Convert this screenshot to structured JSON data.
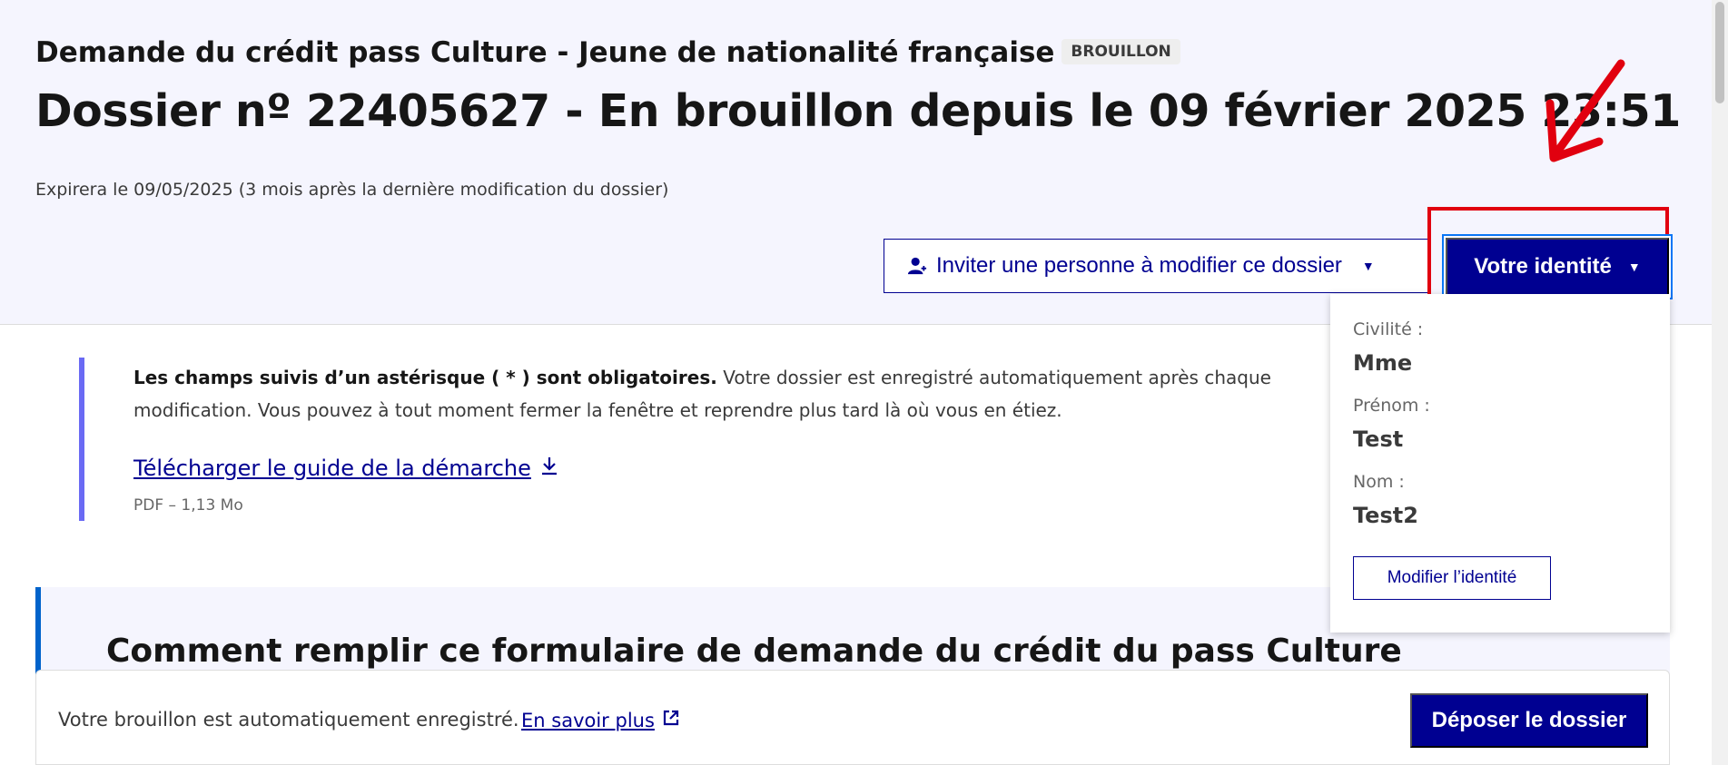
{
  "header": {
    "procedure_title": "Demande du crédit pass Culture - Jeune de nationalité française",
    "status_badge": "BROUILLON",
    "dossier_title": "Dossier nº 22405627 - En brouillon depuis le 09 février 2025 23:51",
    "expiry_text": "Expirera le 09/05/2025 (3 mois après la dernière modification du dossier)"
  },
  "actions": {
    "invite_label": "Inviter une personne à modifier ce dossier",
    "identity_label": "Votre identité",
    "caret_glyph": "▼"
  },
  "identity_dropdown": {
    "civility_label": "Civilité :",
    "civility_value": "Mme",
    "firstname_label": "Prénom :",
    "firstname_value": "Test",
    "lastname_label": "Nom :",
    "lastname_value": "Test2",
    "modify_label": "Modifier l’identité"
  },
  "notice": {
    "required_bold": "Les champs suivis d’un astérisque ( * ) sont obligatoires.",
    "autosave_text": " Votre dossier est enregistré automatiquement après chaque modification. Vous pouvez à tout moment fermer la fenêtre et reprendre plus tard là où vous en étiez.",
    "guide_link": "Télécharger le guide de la démarche",
    "guide_meta": "PDF – 1,13 Mo"
  },
  "howto": {
    "title": "Comment remplir ce formulaire de demande du crédit du pass Culture"
  },
  "save_bar": {
    "text": "Votre brouillon est automatiquement enregistré.",
    "learn_more": "En savoir plus",
    "submit_label": "Déposer le dossier"
  },
  "icons": {
    "invite": "person-add-icon",
    "caret": "caret-down-icon",
    "download": "download-icon",
    "external": "external-link-icon",
    "annotation": "red-arrow-annotation"
  },
  "colors": {
    "primary": "#000091",
    "header_bg": "#f5f5fe",
    "annotation": "#e1000f",
    "notice_border": "#6a6af4",
    "howto_border": "#0063cb"
  }
}
